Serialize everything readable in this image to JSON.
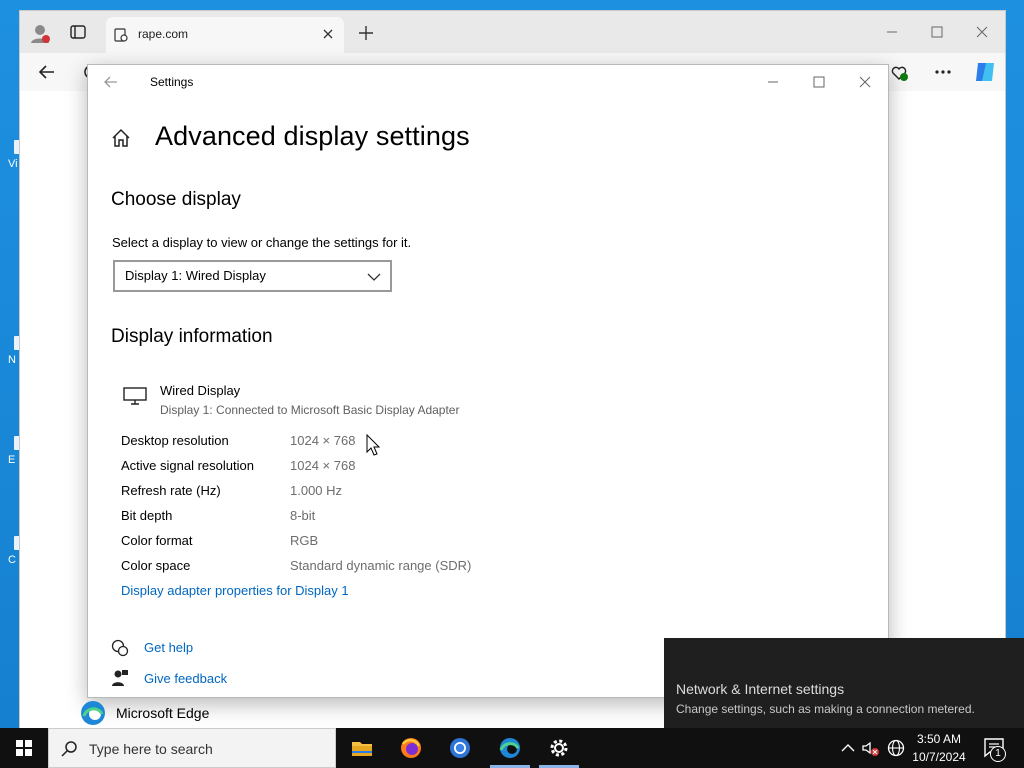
{
  "desktop": {
    "icon_labels": [
      "Vi",
      "N",
      "E",
      "C"
    ]
  },
  "edge": {
    "tab_title": "rape.com",
    "app_label": "Microsoft Edge"
  },
  "settings": {
    "window_title": "Settings",
    "heading": "Advanced display settings",
    "choose_display": {
      "title": "Choose display",
      "description": "Select a display to view or change the settings for it.",
      "selected": "Display 1: Wired Display"
    },
    "display_info": {
      "title": "Display information",
      "display_name": "Wired Display",
      "display_sub": "Display 1: Connected to Microsoft Basic Display Adapter",
      "rows": [
        {
          "label": "Desktop resolution",
          "value": "1024 × 768"
        },
        {
          "label": "Active signal resolution",
          "value": "1024 × 768"
        },
        {
          "label": "Refresh rate (Hz)",
          "value": "1.000 Hz"
        },
        {
          "label": "Bit depth",
          "value": "8-bit"
        },
        {
          "label": "Color format",
          "value": "RGB"
        },
        {
          "label": "Color space",
          "value": "Standard dynamic range (SDR)"
        }
      ],
      "adapter_link": "Display adapter properties for Display 1"
    },
    "get_help": "Get help",
    "give_feedback": "Give feedback"
  },
  "toast": {
    "title": "Network & Internet settings",
    "subtitle": "Change settings, such as making a connection metered."
  },
  "taskbar": {
    "search_placeholder": "Type here to search",
    "time": "3:50 AM",
    "date": "10/7/2024",
    "notification_count": "1"
  },
  "colors": {
    "link": "#0067c0",
    "desktop": "#1e90e0",
    "taskbar": "#101010"
  }
}
